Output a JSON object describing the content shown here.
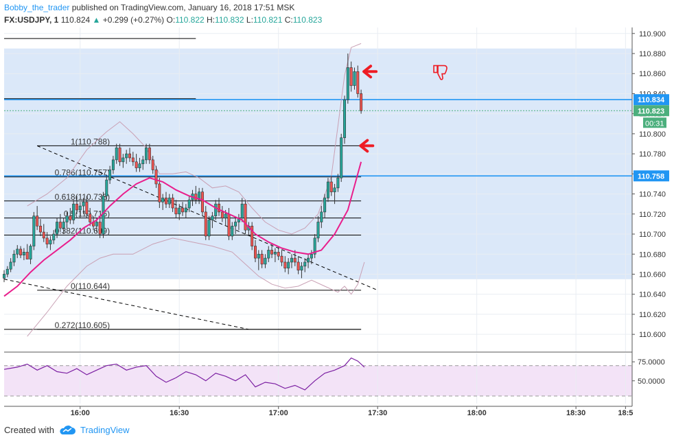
{
  "header": {
    "author": "Bobby_the_trader",
    "published": "published on TradingView.com, January 16, 2018 17:51 MSK",
    "symbol": "FX:USDJPY, 1",
    "last": "110.824",
    "change_arrow": "▲",
    "change": "+0.299 (+0.27%)",
    "o_label": "O:",
    "o": "110.822",
    "h_label": "H:",
    "h": "110.832",
    "l_label": "L:",
    "l": "110.821",
    "c_label": "C:",
    "c": "110.823"
  },
  "footer": {
    "created_with": "Created with",
    "brand": "TradingView",
    "brand_icon": "cloud-logo-icon"
  },
  "colors": {
    "price_band": "#dbe8f9",
    "rsi_band": "#f3e3f7",
    "candle_up": "#26a69a",
    "candle_down": "#ef5350",
    "ma": "#e91e8c",
    "bollinger": "#c9a0b4",
    "level_line": "#2196f3",
    "last_tag": "#4caf7d",
    "rsi_line": "#7b1fa2",
    "arrow": "#ee1c24"
  },
  "chart_data": {
    "type": "candlestick",
    "title": "FX:USDJPY, 1",
    "ylim": [
      110.583,
      110.906
    ],
    "yticks": [
      "110.900",
      "110.880",
      "110.860",
      "110.840",
      "110.820",
      "110.800",
      "110.780",
      "110.760",
      "110.740",
      "110.720",
      "110.700",
      "110.680",
      "110.660",
      "110.640",
      "110.620",
      "110.600"
    ],
    "xticks": [
      "16:00",
      "16:30",
      "17:00",
      "17:30",
      "18:00",
      "18:30",
      "18:5"
    ],
    "xtick_minutes": [
      960,
      990,
      1020,
      1050,
      1080,
      1110,
      1125
    ],
    "xlim_minutes": [
      937,
      1127
    ],
    "price_band": [
      110.655,
      110.885
    ],
    "price_tags": [
      {
        "value": 110.834,
        "label": "110.834",
        "kind": "level"
      },
      {
        "value": 110.823,
        "label": "110.823",
        "kind": "last"
      },
      {
        "value": 110.758,
        "label": "110.758",
        "kind": "level"
      }
    ],
    "countdown": "00:31",
    "horizontal_levels": [
      110.834,
      110.758
    ],
    "fibonacci": [
      {
        "label": "1(110.788)",
        "value": 110.788
      },
      {
        "label": "0.786(110.757)",
        "value": 110.757
      },
      {
        "label": "0.618(110.733)",
        "value": 110.733
      },
      {
        "label": "0.5(110.716)",
        "value": 110.716
      },
      {
        "label": "0.382(110.699)",
        "value": 110.699
      },
      {
        "label": "0(110.644)",
        "value": 110.644
      },
      {
        "label": "0.272(110.605)",
        "value": 110.605
      }
    ],
    "extra_level": 110.895,
    "trendlines": [
      {
        "from": [
          937,
          110.655
        ],
        "to": [
          1011,
          110.605
        ]
      },
      {
        "from": [
          947,
          110.788
        ],
        "to": [
          1050,
          110.644
        ]
      }
    ],
    "candles": [
      [
        937,
        110.656,
        110.664,
        110.652,
        110.66
      ],
      [
        938,
        110.66,
        110.668,
        110.657,
        110.665
      ],
      [
        939,
        110.665,
        110.676,
        110.662,
        110.672
      ],
      [
        940,
        110.672,
        110.684,
        110.668,
        110.68
      ],
      [
        941,
        110.68,
        110.689,
        110.676,
        110.685
      ],
      [
        942,
        110.685,
        110.688,
        110.676,
        110.679
      ],
      [
        943,
        110.679,
        110.686,
        110.674,
        110.682
      ],
      [
        944,
        110.682,
        110.69,
        110.678,
        110.675
      ],
      [
        945,
        110.675,
        110.69,
        110.67,
        110.688
      ],
      [
        946,
        110.688,
        110.722,
        110.684,
        110.718
      ],
      [
        947,
        110.718,
        110.728,
        110.704,
        110.708
      ],
      [
        948,
        110.708,
        110.715,
        110.698,
        110.702
      ],
      [
        949,
        110.702,
        110.71,
        110.692,
        110.696
      ],
      [
        950,
        110.696,
        110.702,
        110.686,
        110.69
      ],
      [
        951,
        110.69,
        110.698,
        110.684,
        110.694
      ],
      [
        952,
        110.694,
        110.704,
        110.69,
        110.7
      ],
      [
        953,
        110.7,
        110.716,
        110.696,
        110.712
      ],
      [
        954,
        110.712,
        110.72,
        110.702,
        110.706
      ],
      [
        955,
        110.706,
        110.716,
        110.7,
        110.712
      ],
      [
        956,
        110.712,
        110.722,
        110.706,
        110.718
      ],
      [
        957,
        110.718,
        110.726,
        110.71,
        110.714
      ],
      [
        958,
        110.714,
        110.734,
        110.71,
        110.73
      ],
      [
        959,
        110.73,
        110.738,
        110.72,
        110.724
      ],
      [
        960,
        110.724,
        110.732,
        110.716,
        110.728
      ],
      [
        961,
        110.728,
        110.736,
        110.72,
        110.732
      ],
      [
        962,
        110.732,
        110.738,
        110.716,
        110.72
      ],
      [
        963,
        110.72,
        110.726,
        110.708,
        110.712
      ],
      [
        964,
        110.712,
        110.718,
        110.704,
        110.708
      ],
      [
        965,
        110.708,
        110.716,
        110.702,
        110.712
      ],
      [
        966,
        110.712,
        110.718,
        110.696,
        110.7
      ],
      [
        967,
        110.7,
        110.742,
        110.696,
        110.738
      ],
      [
        968,
        110.738,
        110.758,
        110.734,
        110.754
      ],
      [
        969,
        110.754,
        110.768,
        110.75,
        110.764
      ],
      [
        970,
        110.764,
        110.778,
        110.76,
        110.774
      ],
      [
        971,
        110.774,
        110.79,
        110.77,
        110.786
      ],
      [
        972,
        110.786,
        110.79,
        110.768,
        110.772
      ],
      [
        973,
        110.772,
        110.78,
        110.766,
        110.776
      ],
      [
        974,
        110.776,
        110.784,
        110.77,
        110.78
      ],
      [
        975,
        110.78,
        110.786,
        110.772,
        110.776
      ],
      [
        976,
        110.776,
        110.782,
        110.768,
        110.772
      ],
      [
        977,
        110.772,
        110.78,
        110.762,
        110.766
      ],
      [
        978,
        110.766,
        110.776,
        110.762,
        110.77
      ],
      [
        979,
        110.77,
        110.778,
        110.764,
        110.774
      ],
      [
        980,
        110.774,
        110.79,
        110.77,
        110.786
      ],
      [
        981,
        110.786,
        110.79,
        110.77,
        110.774
      ],
      [
        982,
        110.774,
        110.778,
        110.76,
        110.764
      ],
      [
        983,
        110.764,
        110.768,
        110.746,
        110.75
      ],
      [
        984,
        110.75,
        110.756,
        110.726,
        110.732
      ],
      [
        985,
        110.732,
        110.74,
        110.724,
        110.736
      ],
      [
        986,
        110.736,
        110.742,
        110.726,
        110.73
      ],
      [
        987,
        110.73,
        110.74,
        110.726,
        110.736
      ],
      [
        988,
        110.736,
        110.74,
        110.722,
        110.726
      ],
      [
        989,
        110.726,
        110.734,
        110.716,
        110.72
      ],
      [
        990,
        110.72,
        110.73,
        110.714,
        110.726
      ],
      [
        991,
        110.726,
        110.732,
        110.718,
        110.722
      ],
      [
        992,
        110.722,
        110.73,
        110.716,
        110.726
      ],
      [
        993,
        110.726,
        110.738,
        110.722,
        110.734
      ],
      [
        994,
        110.734,
        110.744,
        110.728,
        110.74
      ],
      [
        995,
        110.74,
        110.748,
        110.73,
        110.734
      ],
      [
        996,
        110.734,
        110.746,
        110.73,
        110.742
      ],
      [
        997,
        110.742,
        110.746,
        110.718,
        110.722
      ],
      [
        998,
        110.722,
        110.728,
        110.694,
        110.698
      ],
      [
        999,
        110.698,
        110.718,
        110.694,
        110.714
      ],
      [
        1000,
        110.714,
        110.722,
        110.706,
        110.718
      ],
      [
        1001,
        110.718,
        110.734,
        110.714,
        110.73
      ],
      [
        1002,
        110.73,
        110.736,
        110.718,
        110.722
      ],
      [
        1003,
        110.722,
        110.728,
        110.712,
        110.716
      ],
      [
        1004,
        110.716,
        110.724,
        110.708,
        110.72
      ],
      [
        1005,
        110.72,
        110.726,
        110.694,
        110.698
      ],
      [
        1006,
        110.698,
        110.712,
        110.694,
        110.708
      ],
      [
        1007,
        110.708,
        110.716,
        110.7,
        110.712
      ],
      [
        1008,
        110.712,
        110.72,
        110.704,
        110.716
      ],
      [
        1009,
        110.716,
        110.736,
        110.712,
        110.73
      ],
      [
        1010,
        110.73,
        110.734,
        110.7,
        110.704
      ],
      [
        1011,
        110.704,
        110.712,
        110.698,
        110.708
      ],
      [
        1012,
        110.708,
        110.712,
        110.684,
        110.688
      ],
      [
        1013,
        110.688,
        110.694,
        110.672,
        110.676
      ],
      [
        1014,
        110.676,
        110.684,
        110.664,
        110.68
      ],
      [
        1015,
        110.68,
        110.684,
        110.666,
        110.67
      ],
      [
        1016,
        110.67,
        110.68,
        110.666,
        110.676
      ],
      [
        1017,
        110.676,
        110.688,
        110.672,
        110.684
      ],
      [
        1018,
        110.684,
        110.69,
        110.676,
        110.68
      ],
      [
        1019,
        110.68,
        110.686,
        110.672,
        110.682
      ],
      [
        1020,
        110.682,
        110.688,
        110.674,
        110.678
      ],
      [
        1021,
        110.678,
        110.684,
        110.668,
        110.672
      ],
      [
        1022,
        110.672,
        110.678,
        110.662,
        110.666
      ],
      [
        1023,
        110.666,
        110.676,
        110.66,
        110.672
      ],
      [
        1024,
        110.672,
        110.68,
        110.666,
        110.676
      ],
      [
        1025,
        110.676,
        110.684,
        110.668,
        110.672
      ],
      [
        1026,
        110.672,
        110.678,
        110.66,
        110.664
      ],
      [
        1027,
        110.664,
        110.672,
        110.656,
        110.668
      ],
      [
        1028,
        110.668,
        110.676,
        110.662,
        110.672
      ],
      [
        1029,
        110.672,
        110.68,
        110.666,
        110.676
      ],
      [
        1030,
        110.676,
        110.684,
        110.67,
        110.68
      ],
      [
        1031,
        110.68,
        110.7,
        110.676,
        110.696
      ],
      [
        1032,
        110.696,
        110.718,
        110.692,
        110.712
      ],
      [
        1033,
        110.712,
        110.728,
        110.706,
        110.722
      ],
      [
        1034,
        110.722,
        110.74,
        110.716,
        110.736
      ],
      [
        1035,
        110.736,
        110.756,
        110.732,
        110.752
      ],
      [
        1036,
        110.752,
        110.758,
        110.738,
        110.742
      ],
      [
        1037,
        110.742,
        110.75,
        110.73,
        110.746
      ],
      [
        1038,
        110.746,
        110.76,
        110.742,
        110.756
      ],
      [
        1039,
        110.756,
        110.8,
        110.752,
        110.796
      ],
      [
        1040,
        110.796,
        110.838,
        110.79,
        110.834
      ],
      [
        1041,
        110.834,
        110.88,
        110.83,
        110.866
      ],
      [
        1042,
        110.866,
        110.872,
        110.842,
        110.848
      ],
      [
        1043,
        110.848,
        110.866,
        110.844,
        110.862
      ],
      [
        1044,
        110.862,
        110.868,
        110.836,
        110.84
      ],
      [
        1045,
        110.84,
        110.844,
        110.82,
        110.823
      ]
    ],
    "ma_sample_points": [
      [
        937,
        110.638
      ],
      [
        941,
        110.648
      ],
      [
        945,
        110.662
      ],
      [
        949,
        110.674
      ],
      [
        953,
        110.684
      ],
      [
        957,
        110.694
      ],
      [
        961,
        110.706
      ],
      [
        965,
        110.714
      ],
      [
        969,
        110.728
      ],
      [
        973,
        110.74
      ],
      [
        977,
        110.75
      ],
      [
        981,
        110.756
      ],
      [
        985,
        110.752
      ],
      [
        989,
        110.744
      ],
      [
        993,
        110.738
      ],
      [
        997,
        110.734
      ],
      [
        1001,
        110.726
      ],
      [
        1005,
        110.72
      ],
      [
        1009,
        110.714
      ],
      [
        1013,
        110.7
      ],
      [
        1017,
        110.692
      ],
      [
        1021,
        110.686
      ],
      [
        1025,
        110.682
      ],
      [
        1029,
        110.68
      ],
      [
        1033,
        110.684
      ],
      [
        1037,
        110.7
      ],
      [
        1041,
        110.724
      ],
      [
        1045,
        110.772
      ]
    ],
    "bb_upper_sample_points": [
      [
        944,
        110.728
      ],
      [
        950,
        110.74
      ],
      [
        956,
        110.756
      ],
      [
        962,
        110.784
      ],
      [
        968,
        110.802
      ],
      [
        972,
        110.812
      ],
      [
        976,
        110.8
      ],
      [
        980,
        110.786
      ],
      [
        984,
        110.76
      ],
      [
        988,
        110.76
      ],
      [
        992,
        110.762
      ],
      [
        996,
        110.756
      ],
      [
        1000,
        110.746
      ],
      [
        1004,
        110.748
      ],
      [
        1008,
        110.742
      ],
      [
        1012,
        110.726
      ],
      [
        1016,
        110.712
      ],
      [
        1020,
        110.704
      ],
      [
        1024,
        110.7
      ],
      [
        1028,
        110.706
      ],
      [
        1032,
        110.72
      ],
      [
        1036,
        110.758
      ],
      [
        1040,
        110.858
      ],
      [
        1042,
        110.886
      ],
      [
        1045,
        110.89
      ]
    ],
    "bb_lower_sample_points": [
      [
        944,
        110.598
      ],
      [
        950,
        110.622
      ],
      [
        956,
        110.648
      ],
      [
        962,
        110.668
      ],
      [
        966,
        110.676
      ],
      [
        970,
        110.68
      ],
      [
        976,
        110.68
      ],
      [
        982,
        110.69
      ],
      [
        988,
        110.696
      ],
      [
        994,
        110.692
      ],
      [
        1000,
        110.688
      ],
      [
        1006,
        110.682
      ],
      [
        1010,
        110.67
      ],
      [
        1014,
        110.658
      ],
      [
        1018,
        110.65
      ],
      [
        1022,
        110.646
      ],
      [
        1026,
        110.648
      ],
      [
        1030,
        110.654
      ],
      [
        1034,
        110.648
      ],
      [
        1038,
        110.642
      ],
      [
        1040,
        110.648
      ],
      [
        1042,
        110.64
      ],
      [
        1044,
        110.65
      ],
      [
        1046,
        110.672
      ]
    ],
    "annotations": [
      {
        "kind": "arrow-left",
        "at": [
          1045,
          110.862
        ]
      },
      {
        "kind": "arrow-left",
        "at": [
          1044,
          110.788
        ]
      },
      {
        "kind": "thumbs-down",
        "at": [
          1067,
          110.868
        ]
      }
    ],
    "rsi": {
      "ylim": [
        20,
        86
      ],
      "yticks": [
        "75.0000",
        "50.0000"
      ],
      "guides": [
        70,
        30
      ],
      "band": [
        30,
        70
      ],
      "values": [
        [
          937,
          65
        ],
        [
          941,
          68
        ],
        [
          944,
          72
        ],
        [
          947,
          64
        ],
        [
          950,
          70
        ],
        [
          953,
          62
        ],
        [
          956,
          60
        ],
        [
          959,
          66
        ],
        [
          962,
          58
        ],
        [
          965,
          64
        ],
        [
          968,
          70
        ],
        [
          971,
          72
        ],
        [
          974,
          64
        ],
        [
          977,
          68
        ],
        [
          980,
          70
        ],
        [
          983,
          56
        ],
        [
          986,
          48
        ],
        [
          989,
          54
        ],
        [
          992,
          62
        ],
        [
          995,
          58
        ],
        [
          998,
          50
        ],
        [
          1001,
          60
        ],
        [
          1004,
          56
        ],
        [
          1007,
          50
        ],
        [
          1010,
          58
        ],
        [
          1013,
          42
        ],
        [
          1016,
          48
        ],
        [
          1019,
          46
        ],
        [
          1022,
          40
        ],
        [
          1025,
          44
        ],
        [
          1028,
          38
        ],
        [
          1031,
          50
        ],
        [
          1034,
          60
        ],
        [
          1037,
          64
        ],
        [
          1040,
          70
        ],
        [
          1042,
          80
        ],
        [
          1044,
          76
        ],
        [
          1046,
          68
        ]
      ]
    }
  }
}
